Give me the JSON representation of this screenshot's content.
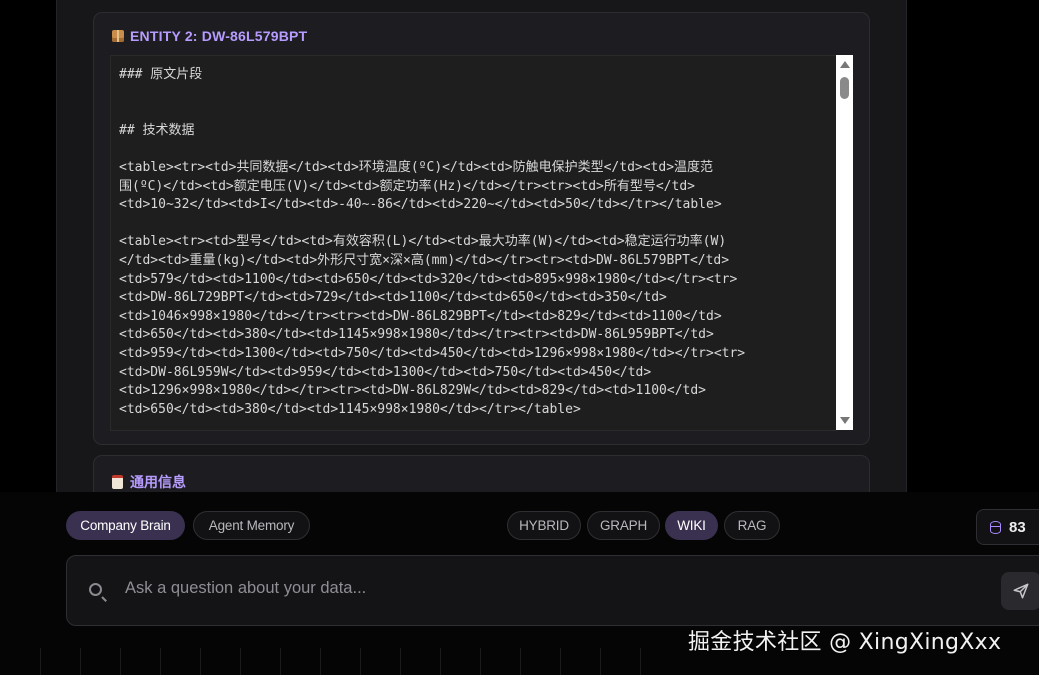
{
  "entity": {
    "title": "ENTITY 2: DW-86L579BPT",
    "content": "### 原文片段\n\n\n## 技术数据\n\n<table><tr><td>共同数据</td><td>环境温度(ºC)</td><td>防触电保护类型</td><td>温度范\n围(ºC)</td><td>额定电压(V)</td><td>额定功率(Hz)</td></tr><tr><td>所有型号</td>\n<td>10~32</td><td>I</td><td>-40~-86</td><td>220~</td><td>50</td></tr></table>\n\n<table><tr><td>型号</td><td>有效容积(L)</td><td>最大功率(W)</td><td>稳定运行功率(W)\n</td><td>重量(kg)</td><td>外形尺寸宽×深×高(mm)</td></tr><tr><td>DW-86L579BPT</td>\n<td>579</td><td>1100</td><td>650</td><td>320</td><td>895×998×1980</td></tr><tr>\n<td>DW-86L729BPT</td><td>729</td><td>1100</td><td>650</td><td>350</td>\n<td>1046×998×1980</td></tr><tr><td>DW-86L829BPT</td><td>829</td><td>1100</td>\n<td>650</td><td>380</td><td>1145×998×1980</td></tr><tr><td>DW-86L959BPT</td>\n<td>959</td><td>1300</td><td>750</td><td>450</td><td>1296×998×1980</td></tr><tr>\n<td>DW-86L959W</td><td>959</td><td>1300</td><td>750</td><td>450</td>\n<td>1296×998×1980</td></tr><tr><td>DW-86L829W</td><td>829</td><td>1100</td>\n<td>650</td><td>380</td><td>1145×998×1980</td></tr></table>"
  },
  "general": {
    "title": "通用信息"
  },
  "memory_tabs": [
    {
      "label": "Company Brain",
      "active": true
    },
    {
      "label": "Agent Memory",
      "active": false
    }
  ],
  "modes": [
    {
      "label": "HYBRID",
      "active": false
    },
    {
      "label": "GRAPH",
      "active": false
    },
    {
      "label": "WIKI",
      "active": true
    },
    {
      "label": "RAG",
      "active": false
    }
  ],
  "doc_count": "83",
  "search": {
    "placeholder": "Ask a question about your data..."
  },
  "watermark": "掘金技术社区 @ XingXingXxx",
  "colors": {
    "accent": "#b79cff",
    "active_pill": "#3a3150"
  },
  "icons": [
    "package-icon",
    "clipboard-icon",
    "database-icon",
    "search-icon",
    "send-icon"
  ]
}
